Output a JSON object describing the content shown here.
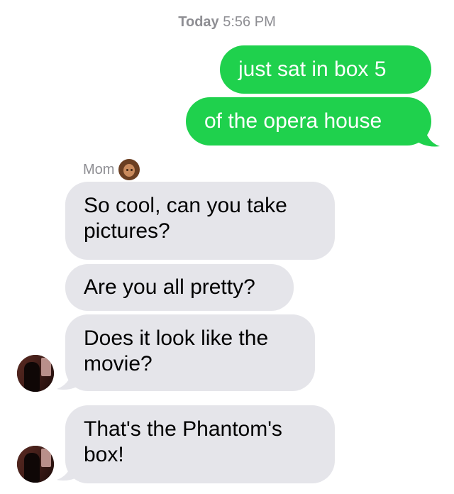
{
  "header": {
    "day": "Today",
    "time": "5:56 PM"
  },
  "colors": {
    "outgoing": "#1fd14d",
    "incoming": "#e5e5ea",
    "meta": "#8e8e93"
  },
  "sender": {
    "name": "Mom",
    "emoji": "woman-emoji-icon"
  },
  "outgoing": [
    {
      "text": "just sat in box 5"
    },
    {
      "text": "of the opera house"
    }
  ],
  "incoming": [
    {
      "line1": "So cool, can you take",
      "line2": "pictures?"
    },
    {
      "line1": "Are you all pretty?"
    },
    {
      "line1": "Does it look like the",
      "line2": "movie?"
    },
    {
      "line1": "That's the Phantom's",
      "line2": "box!"
    }
  ]
}
